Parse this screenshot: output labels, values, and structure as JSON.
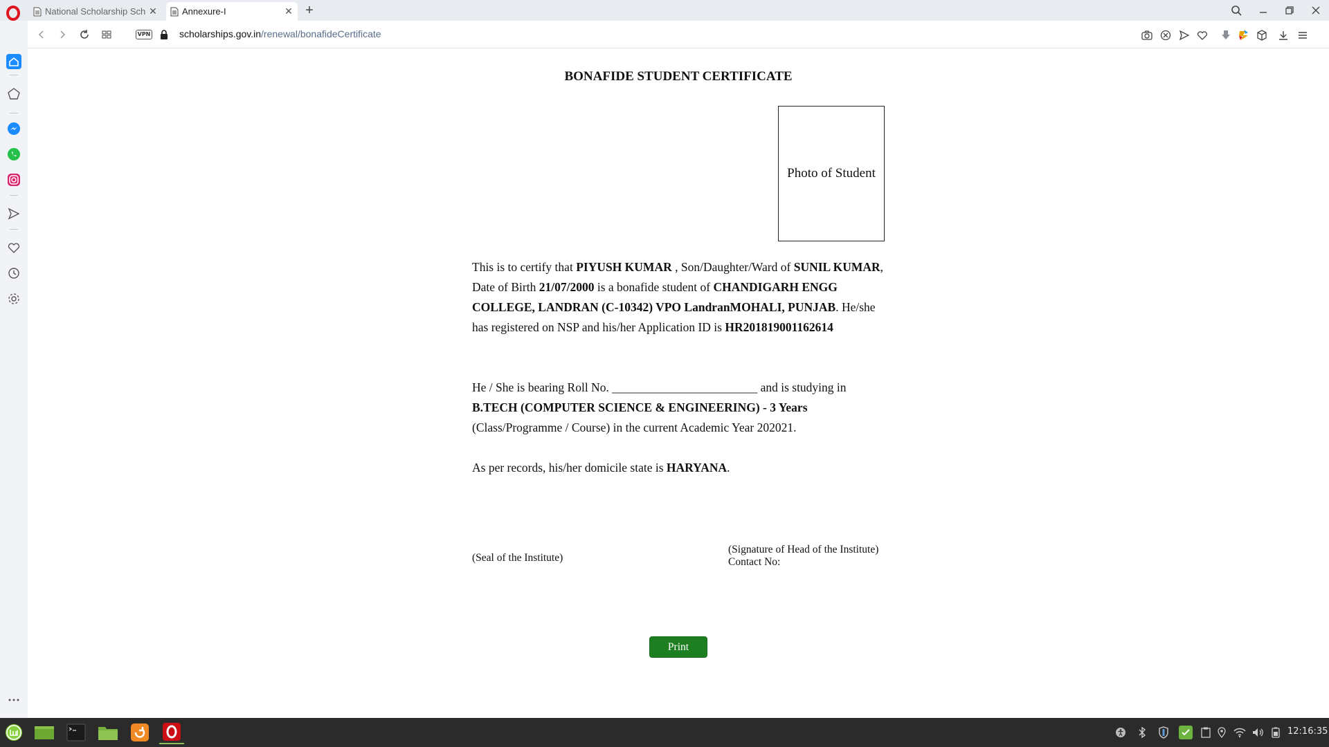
{
  "browser": {
    "tabs": [
      {
        "title": "National Scholarship Sch",
        "active": false
      },
      {
        "title": "Annexure-I",
        "active": true
      }
    ],
    "address": {
      "vpn_label": "VPN",
      "domain": "scholarships.gov.in",
      "path": "/renewal/bonafideCertificate"
    }
  },
  "certificate": {
    "title": "BONAFIDE STUDENT CERTIFICATE",
    "photo_label": "Photo of Student",
    "p1": {
      "t1": "This is to certify that ",
      "name": "PIYUSH KUMAR",
      "t2": " , Son/Daughter/Ward of ",
      "parent": "SUNIL KUMAR",
      "t3": ", Date of Birth ",
      "dob": "21/07/2000",
      "t4": " is a bonafide student of ",
      "institute": "CHANDIGARH ENGG COLLEGE, LANDRAN (C-10342) VPO LandranMOHALI, PUNJAB",
      "t5": ". He/she has registered on NSP and his/her Application ID is ",
      "app_id": "HR201819001162614"
    },
    "p2": {
      "t1": "He / She is bearing Roll No. ________________________ and is studying in ",
      "course": "B.TECH (COMPUTER SCIENCE & ENGINEERING) - 3 Years",
      "t2": " (Class/Programme / Course) in the current Academic Year 202021."
    },
    "p3": {
      "t1": "As per records, his/her domicile state is ",
      "state": "HARYANA",
      "t2": "."
    },
    "seal_label": "(Seal of the Institute)",
    "signature_label": "(Signature of Head of the Institute)",
    "contact_label": "Contact No:",
    "print_button": "Print"
  },
  "taskbar": {
    "clock": "12:16:35"
  },
  "colors": {
    "print_button": "#1e7e22",
    "opera_red": "#e0141e",
    "sidebar_active": "#1a8cff"
  }
}
